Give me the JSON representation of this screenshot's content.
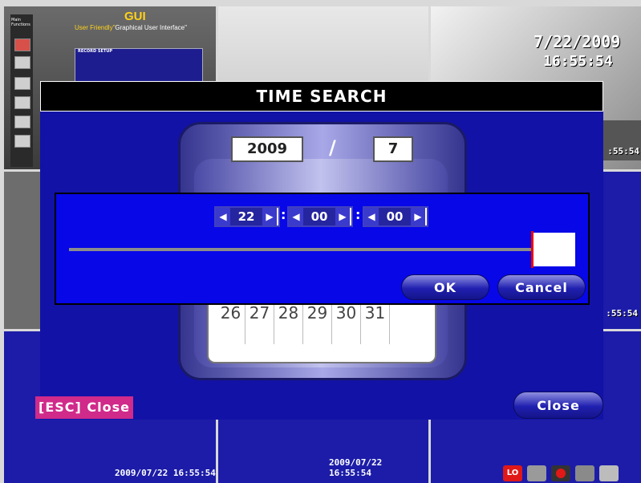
{
  "background": {
    "gui_preview": {
      "title": "GUI",
      "subtitle_prefix": "User Friendly\"",
      "subtitle_highlight": "Graphical User Interface\"",
      "side_label": "Main\nFunctions",
      "menu_header": "RECORD SETUP"
    },
    "camera_overlay_date": "7/22/2009",
    "camera_overlay_time": "16:55:54",
    "side_time_top": ":55:54",
    "side_time_mid": ":55:54",
    "timestamps": [
      "2009/07/22 16:55:54",
      "2009/07/22 16:55:54"
    ]
  },
  "dialog": {
    "title": "TIME SEARCH",
    "year": "2009",
    "separator": "/",
    "month": "7",
    "days_row": [
      "26",
      "27",
      "28",
      "29",
      "30",
      "31",
      ""
    ],
    "esc_label": "[ESC] Close",
    "close_label": "Close"
  },
  "popup": {
    "hour": "22",
    "minute": "00",
    "second": "00",
    "separator": ":",
    "ok_label": "OK",
    "cancel_label": "Cancel"
  },
  "status_icons": [
    "lo-icon",
    "monitor-icon",
    "record-icon",
    "hdd-icon",
    "network-icon"
  ],
  "colors": {
    "dialog_bg": "#1212a6",
    "popup_bg": "#0707e8",
    "esc_bg": "#d02a8a",
    "accent_marker": "#e00000"
  }
}
